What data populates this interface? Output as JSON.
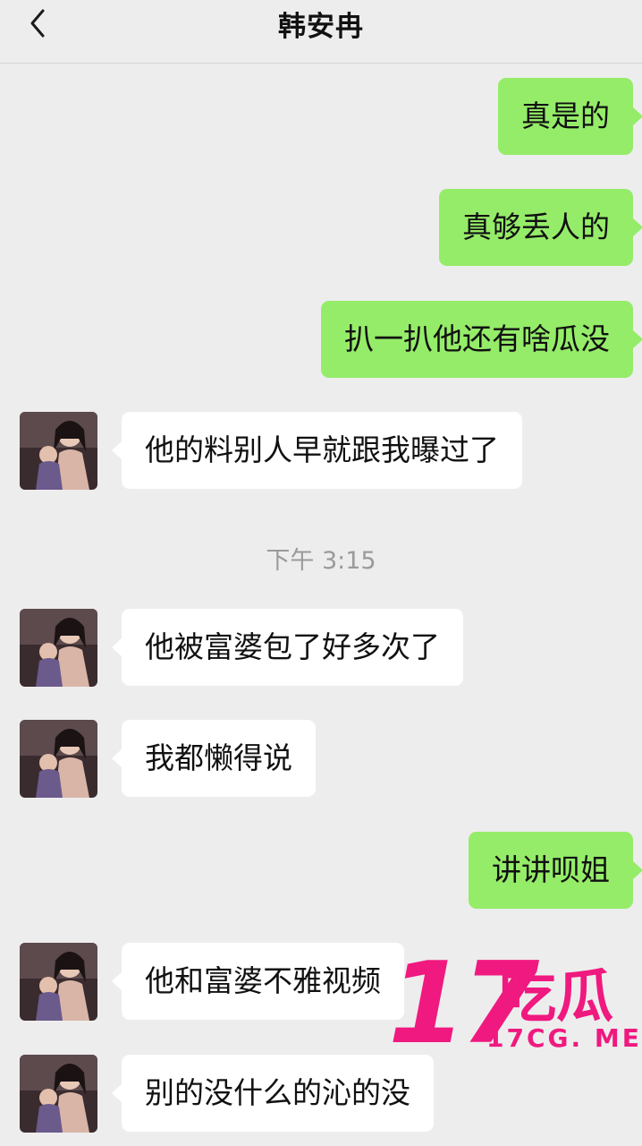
{
  "header": {
    "title": "韩安冉",
    "back_icon": "chevron-left-icon"
  },
  "messages": [
    {
      "side": "sent",
      "text": "真是的"
    },
    {
      "side": "sent",
      "text": "真够丢人的"
    },
    {
      "side": "sent",
      "text": "扒一扒他还有啥瓜没"
    },
    {
      "side": "recv",
      "text": "他的料别人早就跟我曝过了"
    },
    {
      "side": "recv",
      "text": "他被富婆包了好多次了"
    },
    {
      "side": "recv",
      "text": "我都懒得说"
    },
    {
      "side": "sent",
      "text": "讲讲呗姐"
    },
    {
      "side": "recv",
      "text": "他和富婆不雅视频"
    },
    {
      "side": "recv",
      "text": "别的没什么的沁的没"
    }
  ],
  "timestamp": "下午 3:15",
  "watermark": {
    "number": "17",
    "chinese": "吃瓜",
    "url": "17CG. ME"
  },
  "colors": {
    "background": "#ededed",
    "sent_bubble": "#95ec69",
    "received_bubble": "#ffffff",
    "watermark": "#f0197f"
  }
}
